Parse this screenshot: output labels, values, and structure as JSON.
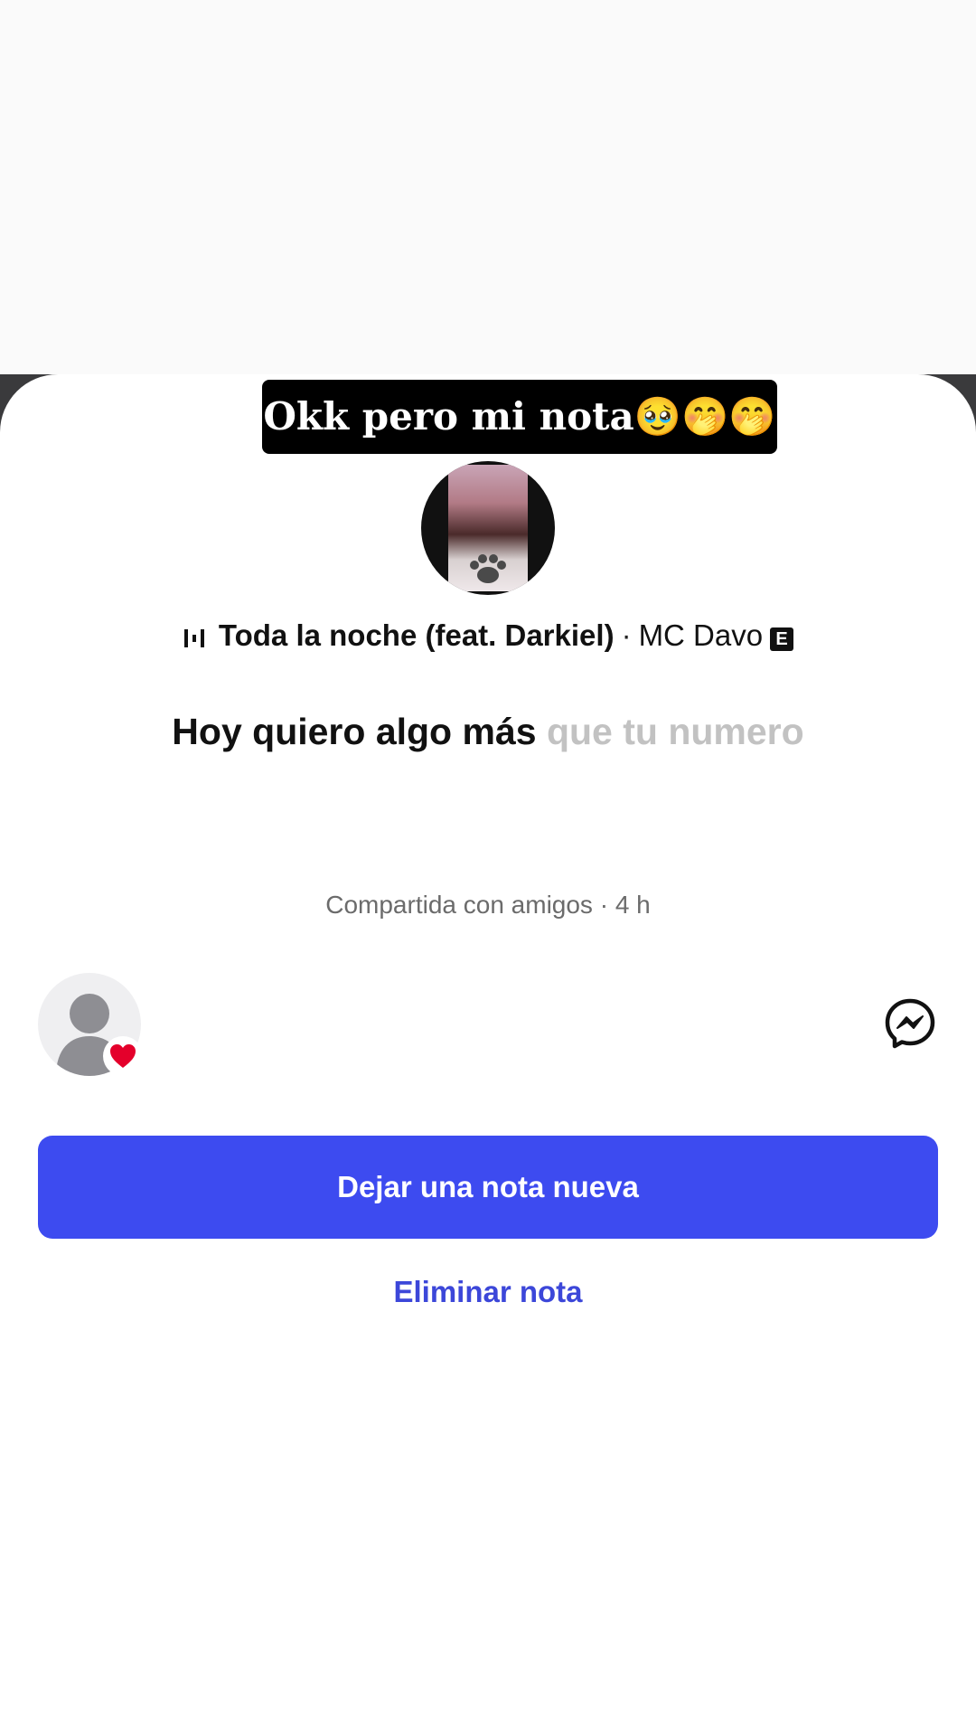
{
  "overlay_caption": "Okk pero mi nota🥹🤭🤭",
  "note": {
    "song_title": "Toda la noche (feat. Darkiel)",
    "separator": "·",
    "artist": "MC Davo",
    "explicit_badge": "E",
    "lyric_sung": "Hoy quiero algo más",
    "lyric_upcoming": "que tu numero",
    "shared_status": "Compartida con amigos · 4 h"
  },
  "icons": {
    "music": "equalizer-icon",
    "reaction": "heart-icon",
    "messenger": "messenger-icon"
  },
  "actions": {
    "primary_label": "Dejar una nota nueva",
    "secondary_label": "Eliminar nota"
  },
  "colors": {
    "primary": "#3d4bf0",
    "link": "#3c47d9",
    "heart": "#e4002b"
  }
}
